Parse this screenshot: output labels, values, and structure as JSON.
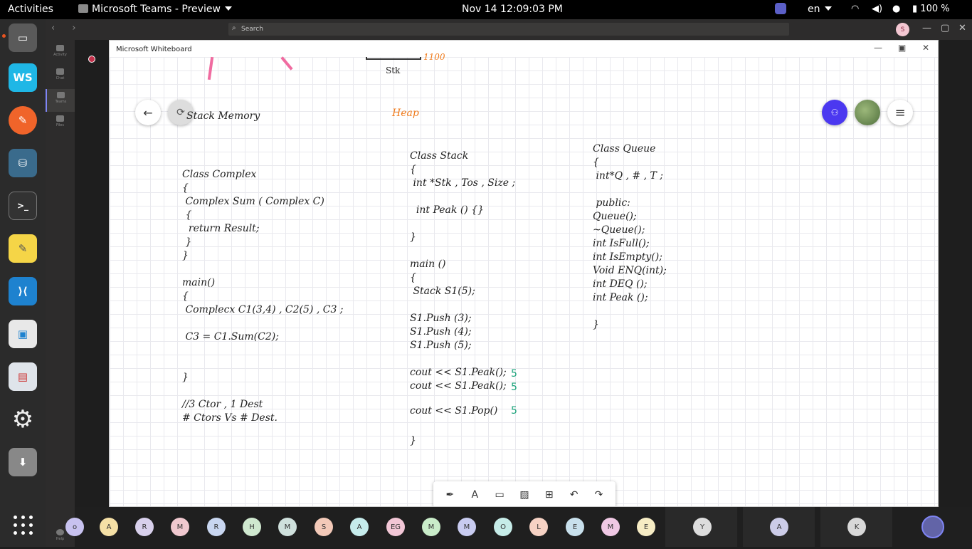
{
  "topbar": {
    "activities": "Activities",
    "app_title": "Microsoft Teams - Preview",
    "clock": "Nov 14  12:09:03 PM",
    "lang": "en",
    "battery": "100 %"
  },
  "teams": {
    "search_placeholder": "Search",
    "user_initial": "S",
    "rail": [
      "Activity",
      "Chat",
      "Teams",
      "Files"
    ],
    "help_label": "Help"
  },
  "whiteboard": {
    "window_title": "Microsoft Whiteboard",
    "top_label": "Stk",
    "top_orange_label": "1100",
    "stack_memory": "Stack Memory",
    "heap": "Heap",
    "complex_code": "Class Complex\n{\n Complex Sum ( Complex C)\n {\n  return Result;\n }\n}\n\nmain()\n{\n Complecx C1(3,4) , C2(5) , C3 ;\n\n C3 = C1.Sum(C2);\n\n\n}\n\n//3 Ctor , 1 Dest\n# Ctors Vs # Dest.",
    "stack_code": "Class Stack\n{\n int *Stk , Tos , Size ;\n\n  int Peak () {}\n\n}\n\nmain ()\n{\n Stack S1(5);\n\nS1.Push (3);\nS1.Push (4);\nS1.Push (5);\n\ncout << S1.Peak();\ncout << S1.Peak();",
    "pop_line": "cout << S1.Pop()",
    "close_brace": "}",
    "results": [
      "5",
      "5",
      "5"
    ],
    "queue_code": "Class Queue\n{\n int*Q , # , T ;\n\n public:\nQueue();\n~Queue();\nint IsFull();\nint IsEmpty();\nVoid ENQ(int);\nint DEQ ();\nint Peak ();\n\n}"
  },
  "participants": [
    "o",
    "A",
    "R",
    "M",
    "R",
    "H",
    "M",
    "S",
    "A",
    "EG",
    "M",
    "M",
    "O",
    "L",
    "E",
    "M",
    "E",
    "Y",
    "A",
    "K"
  ],
  "colors": {
    "invite": "#4b38f0",
    "ink_green": "#1aa37a",
    "ink_orange": "#f07b1c"
  }
}
